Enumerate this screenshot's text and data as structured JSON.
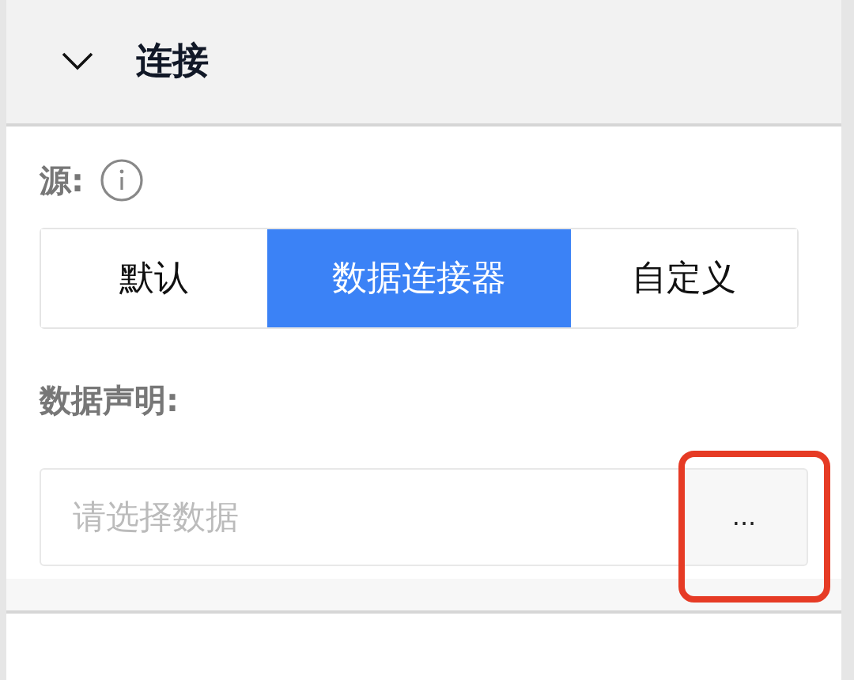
{
  "section": {
    "title": "连接",
    "expanded": true
  },
  "source": {
    "label": "源:"
  },
  "source_options": [
    {
      "label": "默认",
      "selected": false
    },
    {
      "label": "数据连接器",
      "selected": true
    },
    {
      "label": "自定义",
      "selected": false
    }
  ],
  "data_declaration": {
    "label": "数据声明:",
    "placeholder": "请选择数据",
    "button": "...",
    "button_highlighted": true
  }
}
